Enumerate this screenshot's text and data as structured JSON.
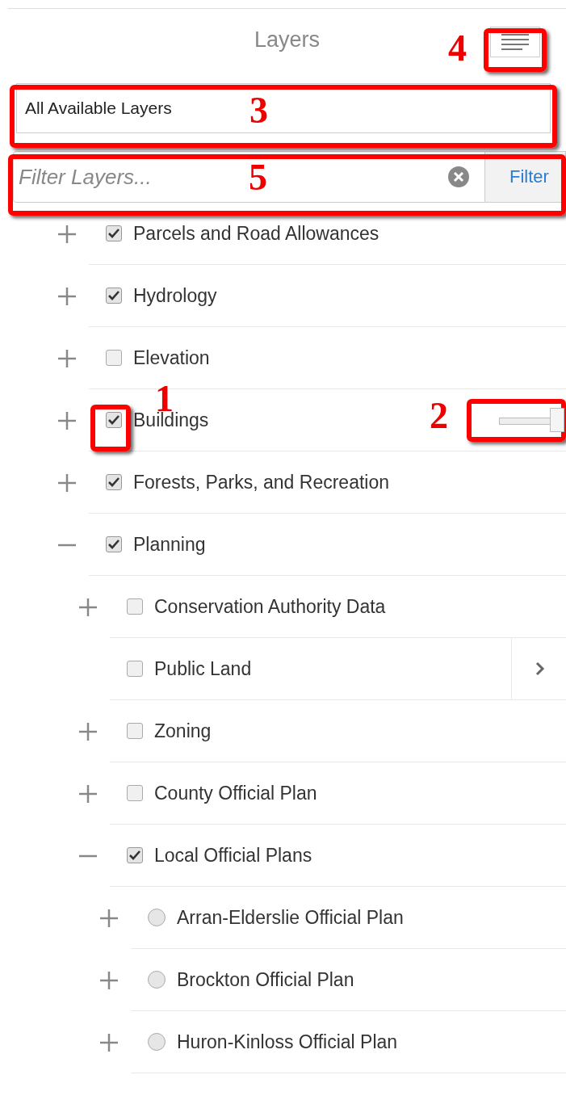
{
  "panel": {
    "title": "Layers"
  },
  "menu": {
    "annotation": "4"
  },
  "layer_source": {
    "value": "All Available Layers",
    "annotation": "3"
  },
  "filter": {
    "placeholder": "Filter Layers...",
    "button": "Filter",
    "annotation": "5"
  },
  "layers": [
    {
      "label": "Parcels and Road Allowances",
      "kind": "checkbox",
      "checked": true,
      "expanded": false
    },
    {
      "label": "Hydrology",
      "kind": "checkbox",
      "checked": true,
      "expanded": false
    },
    {
      "label": "Elevation",
      "kind": "checkbox",
      "checked": false,
      "expanded": false
    },
    {
      "label": "Buildings",
      "kind": "checkbox",
      "checked": true,
      "expanded": false,
      "annotation": "1",
      "opacity": {
        "level": 1,
        "annotation": "2"
      }
    },
    {
      "label": "Forests, Parks, and Recreation",
      "kind": "checkbox",
      "checked": true,
      "expanded": false
    },
    {
      "label": "Planning",
      "kind": "checkbox",
      "checked": true,
      "expanded": true,
      "children": [
        {
          "label": "Conservation Authority Data",
          "kind": "checkbox",
          "checked": false,
          "expanded": false
        },
        {
          "label": "Public Land",
          "kind": "checkbox",
          "checked": false,
          "details": true
        },
        {
          "label": "Zoning",
          "kind": "checkbox",
          "checked": false,
          "expanded": false
        },
        {
          "label": "County Official Plan",
          "kind": "checkbox",
          "checked": false,
          "expanded": false
        },
        {
          "label": "Local Official Plans",
          "kind": "checkbox",
          "checked": true,
          "expanded": true,
          "children": [
            {
              "label": "Arran-Elderslie Official Plan",
              "kind": "radio",
              "selected": false,
              "expanded": false
            },
            {
              "label": "Brockton Official Plan",
              "kind": "radio",
              "selected": false,
              "expanded": false
            },
            {
              "label": "Huron-Kinloss Official Plan",
              "kind": "radio",
              "selected": false,
              "expanded": false
            }
          ]
        }
      ]
    }
  ]
}
